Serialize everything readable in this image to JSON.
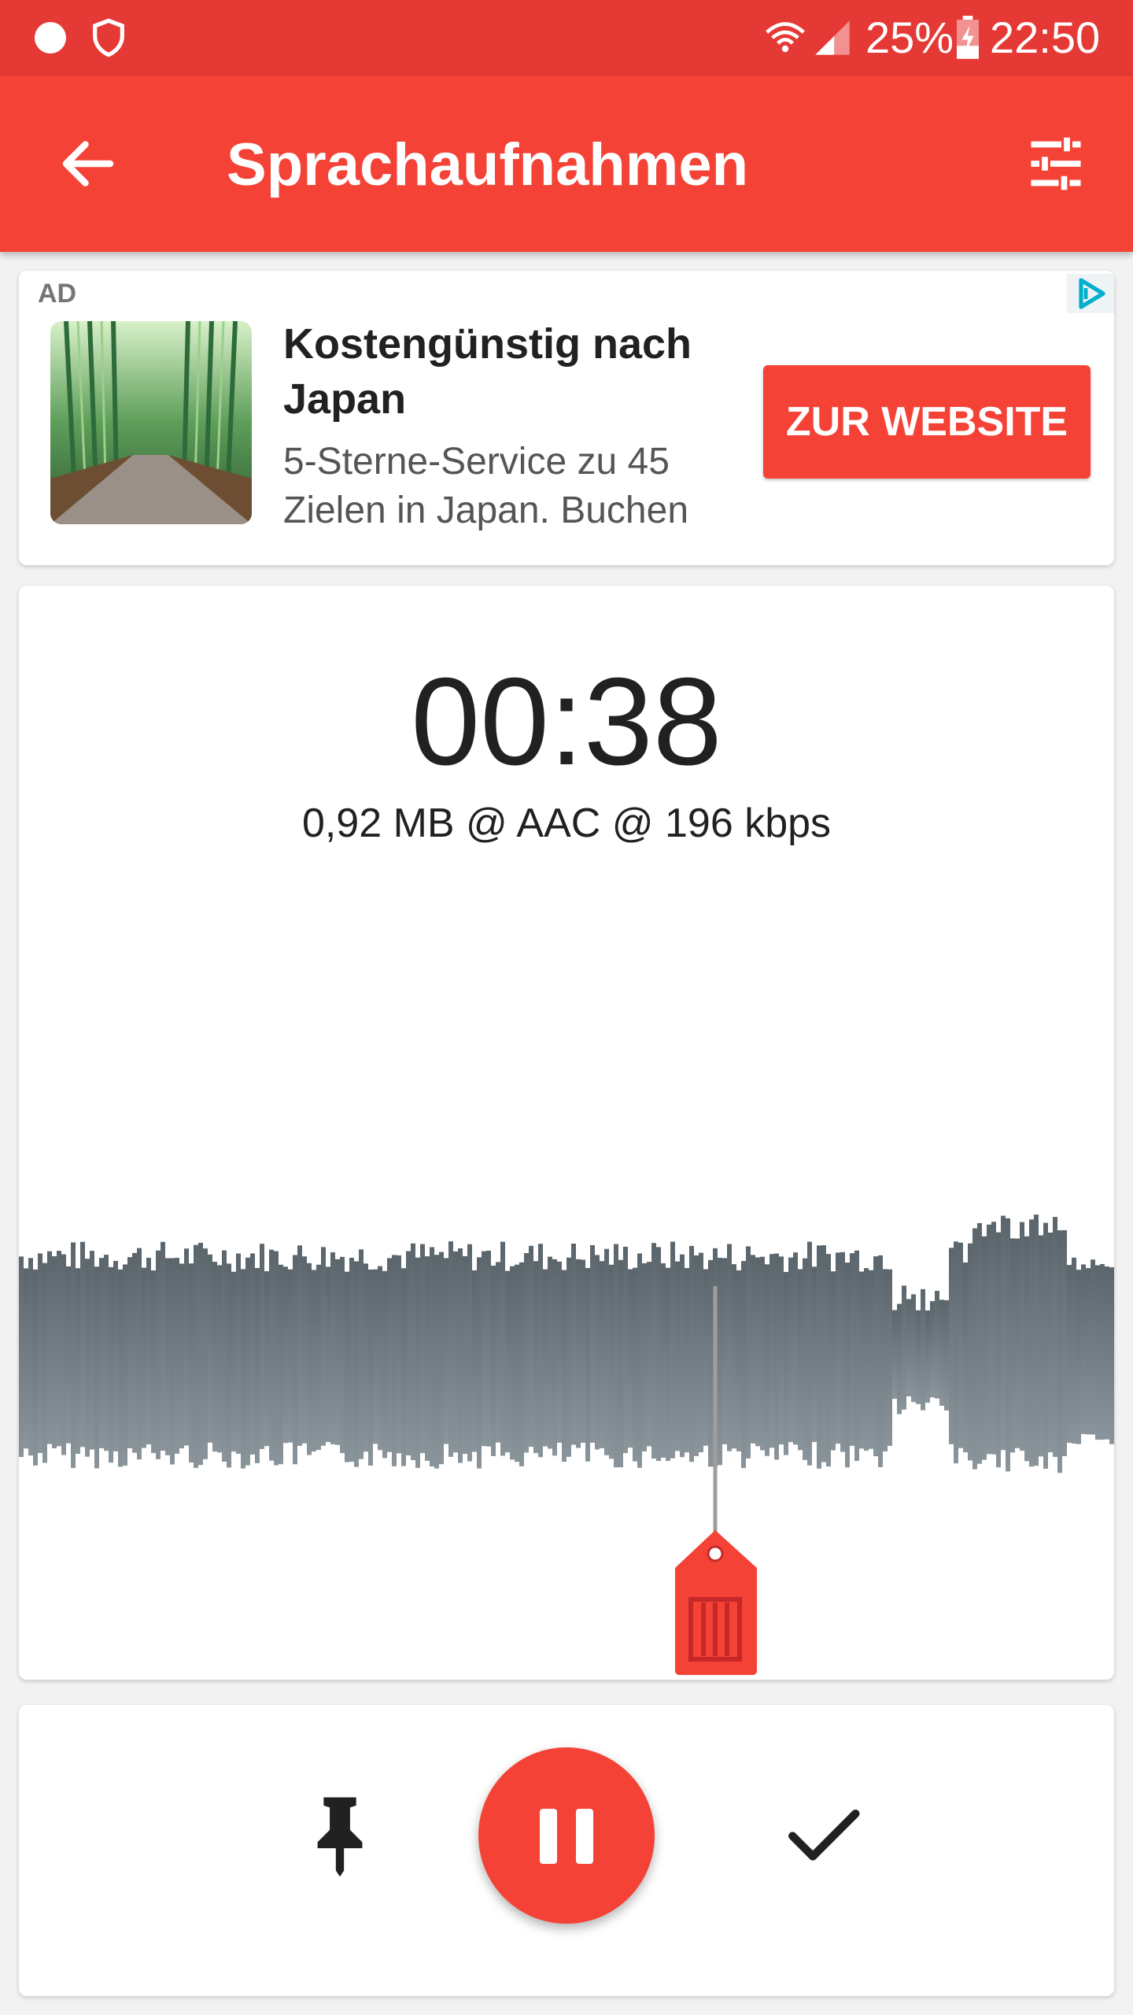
{
  "status_bar": {
    "battery_percent": "25%",
    "time": "22:50",
    "icons": [
      "notification-dot-icon",
      "shield-icon",
      "wifi-icon",
      "cell-signal-icon",
      "battery-charging-icon"
    ]
  },
  "app_bar": {
    "title": "Sprachaufnahmen",
    "back_icon": "arrow-back-icon",
    "settings_icon": "tune-sliders-icon"
  },
  "ad": {
    "label": "AD",
    "headline": "Kostengünstig nach Japan",
    "body": "5-Sterne-Service zu 45 Zielen in Japan. Buchen",
    "cta": "ZUR WEBSITE",
    "image": "bamboo-forest-path"
  },
  "recording": {
    "timer": "00:38",
    "info": "0,92 MB @ AAC @ 196 kbps"
  },
  "controls": {
    "pin_icon": "pin-icon",
    "pause_icon": "pause-icon",
    "done_icon": "check-icon"
  },
  "colors": {
    "status_bar": "#e53935",
    "primary": "#f44336",
    "waveform": "#636e74"
  }
}
